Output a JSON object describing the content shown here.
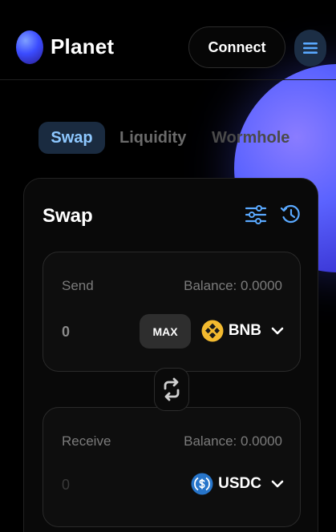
{
  "header": {
    "brand": "Planet",
    "connect_label": "Connect",
    "menu_icon": "menu-icon"
  },
  "tabs": [
    {
      "label": "Swap",
      "active": true
    },
    {
      "label": "Liquidity",
      "active": false
    },
    {
      "label": "Wormhole",
      "active": false
    }
  ],
  "swap_card": {
    "title": "Swap",
    "icons": [
      "settings-sliders-icon",
      "history-icon"
    ],
    "send": {
      "label": "Send",
      "balance": "Balance: 0.0000",
      "amount": "0",
      "max_label": "MAX",
      "token": "BNB",
      "token_icon": "bnb-icon"
    },
    "switch_icon": "swap-arrows-icon",
    "receive": {
      "label": "Receive",
      "balance": "Balance: 0.0000",
      "amount": "0",
      "token": "USDC",
      "token_icon": "usdc-icon"
    }
  },
  "colors": {
    "background": "#000000",
    "accent": "#8ec8ff",
    "tab_active_bg": "#1a2b40",
    "bnb": "#f3ba2f",
    "usdc": "#2775ca"
  }
}
